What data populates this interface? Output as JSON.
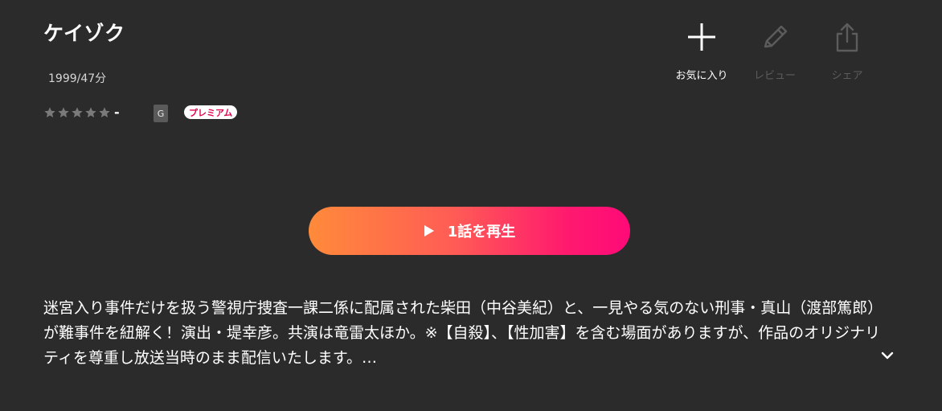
{
  "title": "ケイゾク",
  "meta": "1999/47分",
  "rating": {
    "stars_filled": 0,
    "stars_total": 5,
    "value": "-"
  },
  "badges": {
    "rating_code": "G",
    "premium": "プレミアム"
  },
  "actions": {
    "favorite": "お気に入り",
    "review": "レビュー",
    "share": "シェア"
  },
  "play": {
    "label": "1話を再生"
  },
  "description": "迷宮入り事件だけを扱う警視庁捜査一課二係に配属された柴田（中谷美紀）と、一見やる気のない刑事・真山（渡部篤郎）が難事件を紐解く！演出・堤幸彦。共演は竜雷太ほか。※【自殺】、【性加害】を含む場面がありますが、作品のオリジナリティを尊重し放送当時のまま配信いたします。…",
  "colors": {
    "background": "#2b2b2b",
    "play_gradient_start": "#ff8a3a",
    "play_gradient_end": "#ff0a78",
    "premium_text": "#e6004c",
    "disabled_icon": "#5c5c5c",
    "star_empty": "#7a7a7a"
  },
  "icons": {
    "favorite": "plus-icon",
    "review": "pencil-icon",
    "share": "share-icon",
    "play": "play-icon",
    "expand": "chevron-down-icon",
    "star": "star-icon"
  }
}
